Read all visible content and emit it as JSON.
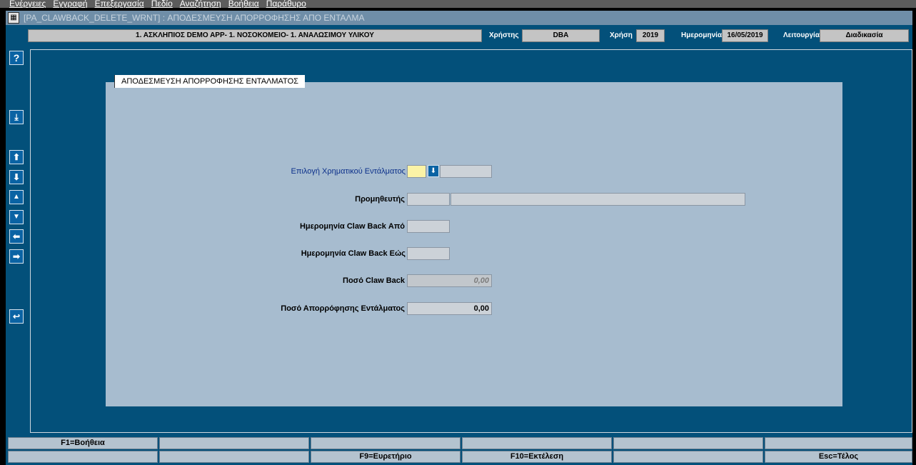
{
  "menu": [
    "Ενέργειες",
    "Εγγραφή",
    "Επεξεργασία",
    "Πεδίο",
    "Αναζήτηση",
    "Βοήθεια",
    "Παράθυρο"
  ],
  "window": {
    "title": "[PA_CLAWBACK_DELETE_WRNT]  :  ΑΠΟΔΕΣΜΕΥΣΗ ΑΠΟΡΡΟΦΗΣΗΣ ΑΠΟ ΕΝΤΑΛΜΑ"
  },
  "header": {
    "org": "1. ΑΣΚΛΗΠΙΟΣ DEMO APP- 1. ΝΟΣΟΚΟΜΕΙΟ- 1. ΑΝΑΛΩΣΙΜΟΥ ΥΛΙΚΟΥ",
    "user_label": "Χρήστης",
    "user": "DBA",
    "year_label": "Χρήση",
    "year": "2019",
    "date_label": "Ημερομηνία",
    "date": "16/05/2019",
    "mode_label": "Λειτουργία",
    "mode": "Διαδικασία"
  },
  "side_icons": [
    "help-icon",
    "list-of-values-icon",
    "first-record-icon",
    "last-record-icon",
    "previous-record-icon",
    "next-record-icon",
    "previous-block-icon",
    "next-block-icon",
    "exit-icon"
  ],
  "form": {
    "title": "ΑΠΟΔΕΣΜΕΥΣΗ ΑΠΟΡΡΟΦΗΣΗΣ ΕΝΤΑΛΜΑΤΟΣ",
    "warrant_label": "Επιλογή Χρηματικού Εντάλματος",
    "warrant_value": "",
    "warrant_desc": "",
    "supplier_label": "Προμηθευτής",
    "supplier_code": "",
    "supplier_name": "",
    "date_from_label": "Ημερομηνία Claw Back Από",
    "date_from": "",
    "date_to_label": "Ημερομηνία Claw Back Εώς",
    "date_to": "",
    "clawback_amount_label": "Ποσό Claw Back",
    "clawback_amount": "0,00",
    "absorption_amount_label": "Ποσό Απορρόφησης Εντάλματος",
    "absorption_amount": "0,00"
  },
  "fkeys": {
    "row1": [
      "F1=Βοήθεια",
      "",
      "",
      "",
      "",
      ""
    ],
    "row2": [
      "",
      "",
      "F9=Ευρετήριο",
      "F10=Εκτέλεση",
      "",
      "Esc=Τέλος"
    ]
  },
  "colors": {
    "client_bg": "#03507a",
    "panel_bg": "#a7bccf",
    "required_field": "#fbf3a6"
  }
}
